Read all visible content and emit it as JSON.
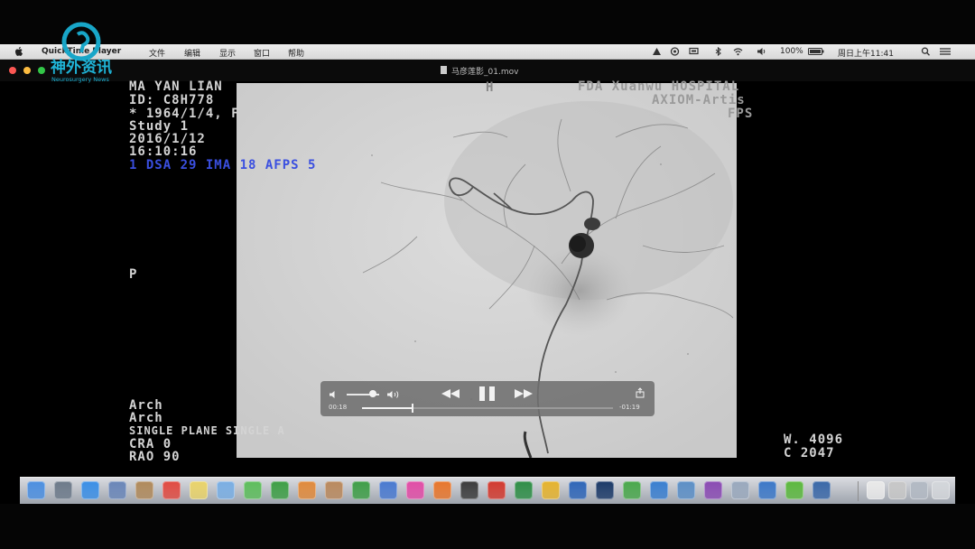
{
  "menubar": {
    "app_name": "QuickTime Player",
    "items": [
      "文件",
      "编辑",
      "显示",
      "窗口",
      "帮助"
    ],
    "battery": "100%",
    "clock": "周日上午11:41"
  },
  "window": {
    "title": "马彦莲影_01.mov",
    "traffic_colors": [
      "#fc5753",
      "#fdbc40",
      "#33c748"
    ]
  },
  "watermark": {
    "cn": "神外资讯",
    "en": "Neurosurgery News"
  },
  "overlay": {
    "patient_name": "MA YAN LIAN",
    "patient_id": "ID: C8H778",
    "dob": "* 1964/1/4, F",
    "study": "Study 1",
    "date": "2016/1/12",
    "time": "16:10:16",
    "sequence": "1  DSA    29 IMA 18 AFPS 5",
    "center_mark": "H",
    "hospital": "FDA Xuanwu HOSPITAL",
    "system": "AXIOM-Artis",
    "fps": "FPS",
    "side_marker": "P",
    "arch1": "Arch",
    "arch2": "Arch",
    "plane": "SINGLE PLANE SINGLE A",
    "cra": "CRA 0",
    "rao": "RAO 90",
    "window_w": "W. 4096",
    "window_c": "C 2047"
  },
  "player": {
    "time_elapsed": "00:18",
    "time_remaining": "-01:19",
    "progress": 0.2,
    "volume": 0.8,
    "volume_icon": "speaker-low-icon",
    "volume_max_icon": "speaker-high-icon",
    "rewind_icon": "rewind-icon",
    "pause_icon": "pause-icon",
    "forward_icon": "fast-forward-icon",
    "share_icon": "share-icon"
  },
  "dock": {
    "icons": [
      {
        "name": "finder-icon",
        "color": "#4c8fe0"
      },
      {
        "name": "launchpad-icon",
        "color": "#6d7a8a"
      },
      {
        "name": "safari-icon",
        "color": "#3b8fe6"
      },
      {
        "name": "preview-icon",
        "color": "#6a86b8"
      },
      {
        "name": "notes-icon",
        "color": "#b08a5c"
      },
      {
        "name": "calendar-icon",
        "color": "#e14b42"
      },
      {
        "name": "stickies-icon",
        "color": "#e9d36a"
      },
      {
        "name": "mail-icon",
        "color": "#7aaee3"
      },
      {
        "name": "messages-icon",
        "color": "#5dbd5c"
      },
      {
        "name": "facetime-icon",
        "color": "#3e9f46"
      },
      {
        "name": "photos-icon",
        "color": "#e08a3c"
      },
      {
        "name": "contacts-icon",
        "color": "#b9895e"
      },
      {
        "name": "numbers-icon",
        "color": "#3f9e48"
      },
      {
        "name": "keynote-icon",
        "color": "#4a7ad0"
      },
      {
        "name": "itunes-icon",
        "color": "#e14da6"
      },
      {
        "name": "ibooks-icon",
        "color": "#e8762c"
      },
      {
        "name": "quicktime-icon",
        "color": "#3c3c3c"
      },
      {
        "name": "wps-icon",
        "color": "#d23a2f"
      },
      {
        "name": "excel-icon",
        "color": "#2f8e47"
      },
      {
        "name": "chrome-icon",
        "color": "#e5b32f"
      },
      {
        "name": "word-icon",
        "color": "#2f66b8"
      },
      {
        "name": "photoshop-icon",
        "color": "#1c3a68"
      },
      {
        "name": "wechat-icon",
        "color": "#4aa84c"
      },
      {
        "name": "qq-icon",
        "color": "#3a7fd0"
      },
      {
        "name": "app-icon-1",
        "color": "#5c8fc6"
      },
      {
        "name": "app-icon-2",
        "color": "#8a4bb3"
      },
      {
        "name": "app-icon-3",
        "color": "#9aa9bd"
      },
      {
        "name": "app-icon-4",
        "color": "#3c78c8"
      },
      {
        "name": "app-icon-5",
        "color": "#5cb83f"
      },
      {
        "name": "app-icon-6",
        "color": "#3a68a8"
      },
      {
        "name": "documents-icon",
        "color": "#e9e9e9"
      },
      {
        "name": "downloads-icon",
        "color": "#c7c7c7"
      },
      {
        "name": "folder-icon",
        "color": "#b2b9c3"
      },
      {
        "name": "trash-icon",
        "color": "#d3d6da"
      }
    ]
  }
}
